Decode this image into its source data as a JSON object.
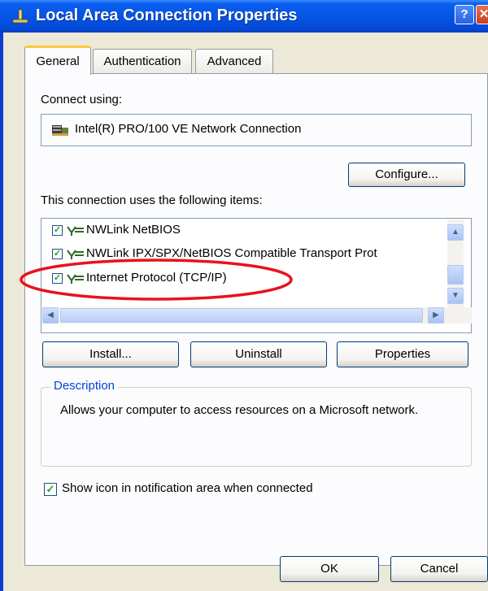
{
  "window": {
    "title": "Local Area Connection Properties",
    "help_glyph": "?",
    "close_glyph": "✕"
  },
  "tabs": [
    {
      "label": "General",
      "selected": true
    },
    {
      "label": "Authentication"
    },
    {
      "label": "Advanced"
    }
  ],
  "general": {
    "connect_using_label": "Connect using:",
    "adapter_name": "Intel(R) PRO/100 VE Network Connection",
    "configure_button": "Configure...",
    "items_label": "This connection uses the following items:",
    "items": [
      {
        "label": "NWLink NetBIOS",
        "checked": true
      },
      {
        "label": "NWLink IPX/SPX/NetBIOS Compatible Transport Prot",
        "checked": true
      },
      {
        "label": "Internet Protocol (TCP/IP)",
        "checked": true
      }
    ],
    "install_button": "Install...",
    "uninstall_button": "Uninstall",
    "properties_button": "Properties",
    "description_legend": "Description",
    "description_text": "Allows your computer to access resources on a Microsoft network.",
    "show_icon_label": "Show icon in notification area when connected",
    "show_icon_checked": true
  },
  "footer": {
    "ok_button": "OK",
    "cancel_button": "Cancel"
  },
  "annotation": {
    "highlight_color": "#e8121c",
    "highlighted_item": "Internet Protocol (TCP/IP)"
  },
  "colors": {
    "titlebar": "#0555e6",
    "dialog_bg": "#ece9d8",
    "panel_bg": "#fcfcfe",
    "legend_text": "#0046d5"
  }
}
